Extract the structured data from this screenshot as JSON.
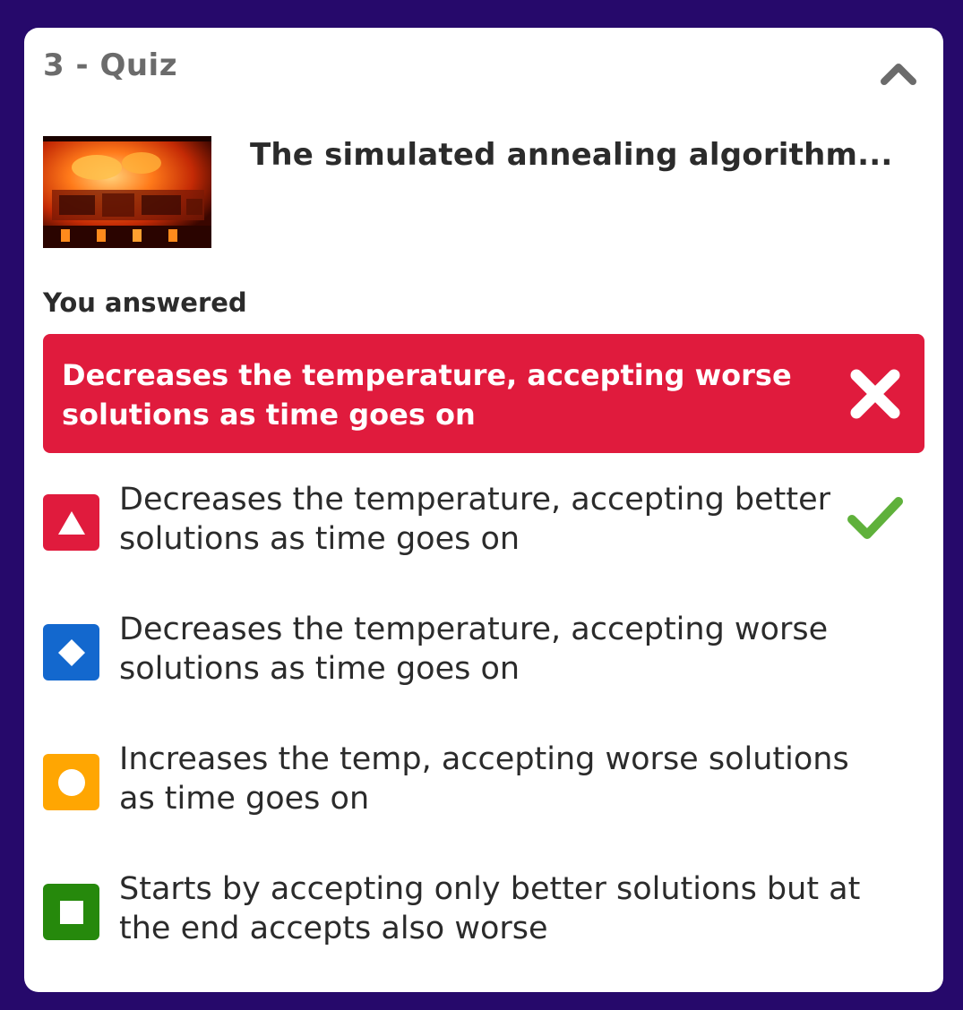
{
  "header": {
    "title": "3 - Quiz",
    "collapse_icon": "chevron-up-icon"
  },
  "question": {
    "text": "The simulated annealing algorithm...",
    "image_icon": "furnace-fire-thumbnail"
  },
  "result": {
    "label": "You answered",
    "answer": "Decreases the temperature, accepting worse solutions as time goes on",
    "status_icon": "close-icon",
    "color": "#e01b3d"
  },
  "options": [
    {
      "text": "Decreases the temperature, accepting better solutions as time goes on",
      "shape": "triangle-icon",
      "color": "#e01b3d",
      "correct": true,
      "correct_icon": "check-icon"
    },
    {
      "text": "Decreases the temperature, accepting worse solutions as time goes on",
      "shape": "diamond-icon",
      "color": "#1368ce"
    },
    {
      "text": "Increases the temp, accepting worse solutions as time goes on",
      "shape": "circle-icon",
      "color": "#ffa602"
    },
    {
      "text": "Starts by accepting only better solutions but at the end accepts also worse",
      "shape": "square-icon",
      "color": "#26890c"
    }
  ],
  "colors": {
    "background": "#26096b",
    "card": "#ffffff",
    "correct_check": "#5fb13b"
  }
}
